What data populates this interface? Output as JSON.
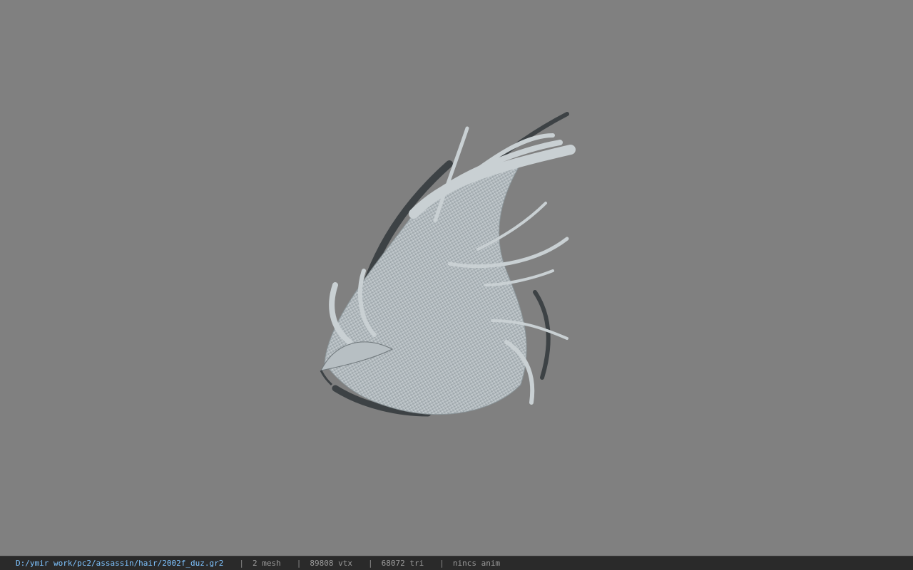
{
  "viewport": {
    "background": "#808080",
    "model_colors": {
      "hair_light": "#c9d0d3",
      "hair_mid": "#9aa3a8",
      "hair_dark": "#3d4245"
    }
  },
  "statusbar": {
    "path": "D:/ymir work/pc2/assassin/hair/2002f_duz.gr2",
    "separator": "|",
    "mesh": "2 mesh",
    "vtx": "89808 vtx",
    "tri": "68072 tri",
    "anim": "nincs anim",
    "path_color": "#7ec3ff"
  }
}
